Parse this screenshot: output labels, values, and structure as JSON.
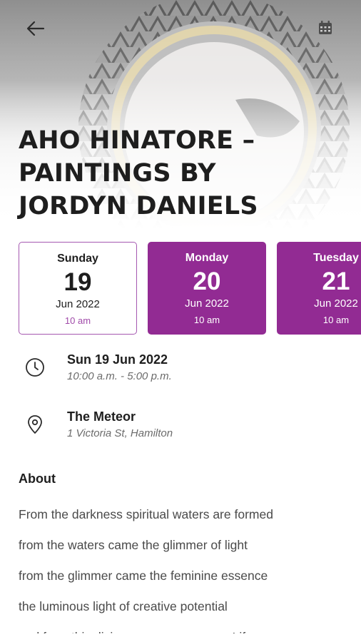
{
  "event": {
    "title_lines": [
      "AHO HINATORE –",
      "PAINTINGS BY",
      "JORDYN DANIELS"
    ]
  },
  "dates": [
    {
      "weekday": "Sunday",
      "day": "19",
      "month_year": "Jun 2022",
      "time": "10 am",
      "selected": true
    },
    {
      "weekday": "Monday",
      "day": "20",
      "month_year": "Jun 2022",
      "time": "10 am",
      "selected": false
    },
    {
      "weekday": "Tuesday",
      "day": "21",
      "month_year": "Jun 2022",
      "time": "10 am",
      "selected": false
    }
  ],
  "when": {
    "date": "Sun 19 Jun 2022",
    "hours": "10:00 a.m. - 5:00 p.m."
  },
  "where": {
    "venue": "The Meteor",
    "address": "1 Victoria St, Hamilton"
  },
  "about": {
    "heading": "About",
    "lines": [
      "From the darkness spiritual waters are formed",
      "from the waters came the glimmer of light",
      "from the glimmer came the feminine essence",
      "the luminous light of creative potential",
      "and from this divine essence emerges Life"
    ]
  },
  "icons": {
    "back": "arrow-left-icon",
    "calendar": "calendar-icon",
    "clock": "clock-icon",
    "location": "map-pin-icon"
  },
  "colors": {
    "accent": "#922b93",
    "accent_light": "#a558b0",
    "text": "#1e1e1e",
    "muted": "#6b6b6b"
  }
}
